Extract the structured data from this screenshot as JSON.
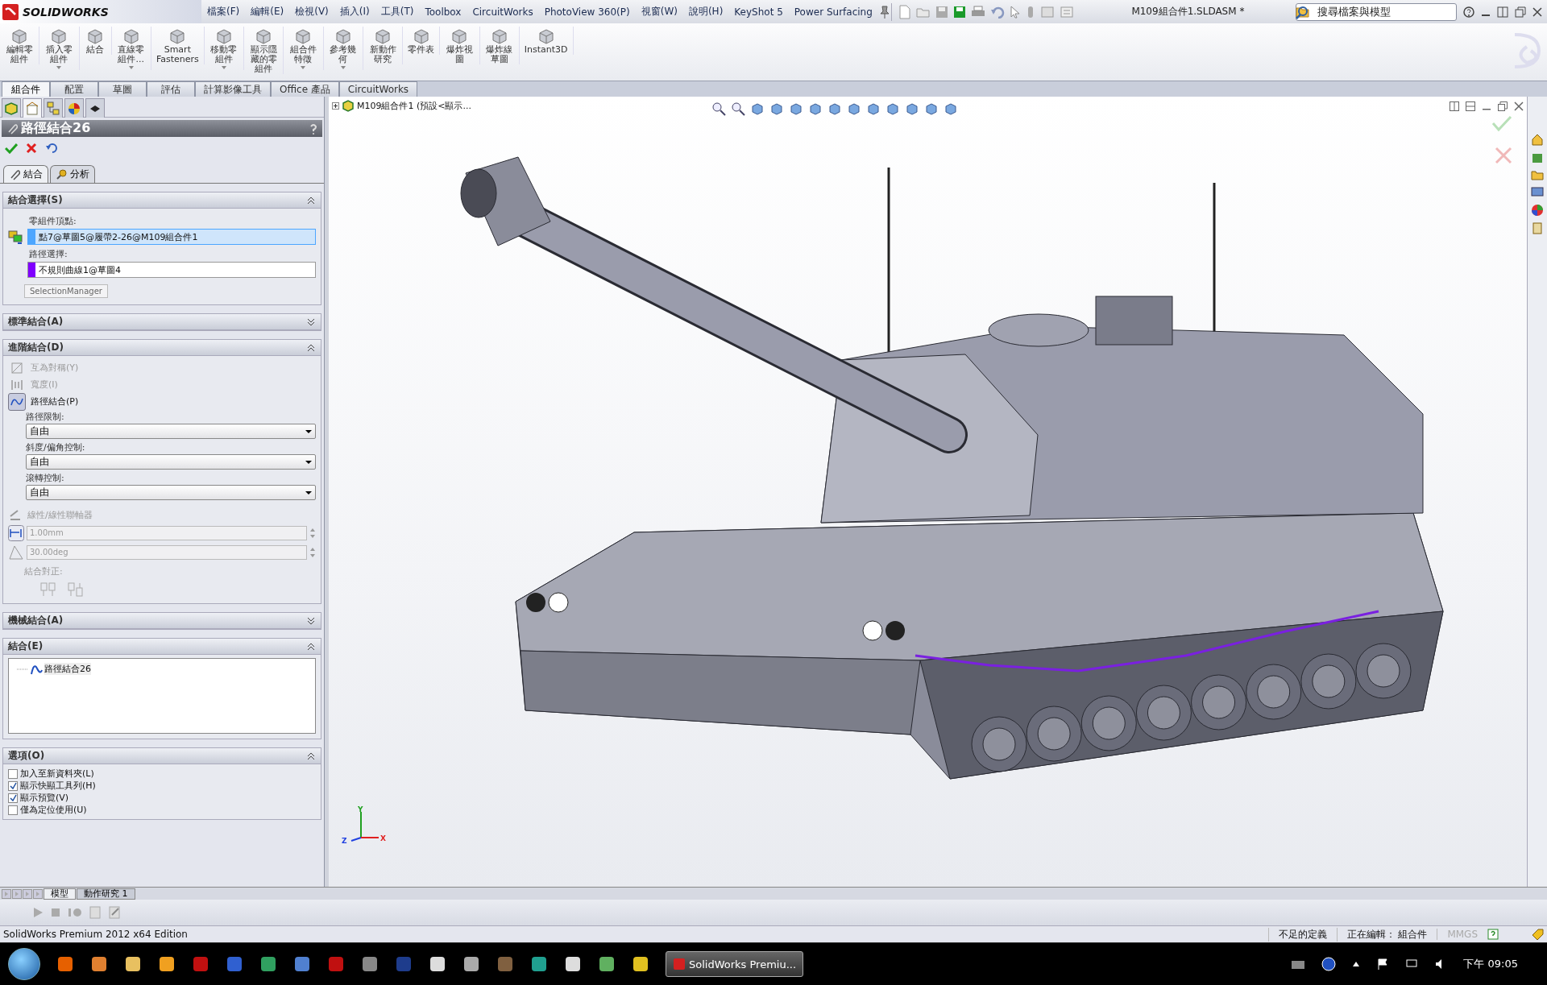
{
  "title_bar": {
    "logo": "SOLIDWORKS",
    "menu": [
      "檔案(F)",
      "編輯(E)",
      "檢視(V)",
      "插入(I)",
      "工具(T)",
      "Toolbox",
      "CircuitWorks",
      "PhotoView 360(P)",
      "視窗(W)",
      "說明(H)",
      "KeyShot 5",
      "Power Surfacing"
    ],
    "document_title": "M109組合件1.SLDASM *",
    "search": {
      "placeholder": "搜尋檔案與模型"
    }
  },
  "ribbon": [
    {
      "label": "編輯零組件",
      "dropdown": false
    },
    {
      "label": "插入零組件",
      "dropdown": true
    },
    {
      "label": "結合",
      "dropdown": false
    },
    {
      "label": "直線零組件...",
      "dropdown": true
    },
    {
      "label": "Smart Fasteners",
      "dropdown": false
    },
    {
      "label": "移動零組件",
      "dropdown": true
    },
    {
      "label": "顯示隱藏的零組件",
      "dropdown": false
    },
    {
      "label": "組合件特徵",
      "dropdown": true
    },
    {
      "label": "參考幾何",
      "dropdown": true
    },
    {
      "label": "新動作研究",
      "dropdown": false
    },
    {
      "label": "零件表",
      "dropdown": false
    },
    {
      "label": "爆炸視圖",
      "dropdown": false
    },
    {
      "label": "爆炸線草圖",
      "dropdown": false
    },
    {
      "label": "Instant3D",
      "dropdown": false
    }
  ],
  "command_tabs": [
    {
      "label": "組合件",
      "selected": true
    },
    {
      "label": "配置",
      "selected": false
    },
    {
      "label": "草圖",
      "selected": false
    },
    {
      "label": "評估",
      "selected": false
    },
    {
      "label": "計算影像工具",
      "selected": false
    },
    {
      "label": "Office 產品",
      "selected": false
    },
    {
      "label": "CircuitWorks",
      "selected": false
    }
  ],
  "manager_tabs": [
    {
      "selected": false
    },
    {
      "selected": true
    },
    {
      "selected": false
    },
    {
      "selected": false
    },
    {
      "selected": false
    }
  ],
  "property_manager": {
    "title": "路徑結合26",
    "tabs": [
      {
        "label": "結合",
        "selected": true
      },
      {
        "label": "分析",
        "selected": false
      }
    ],
    "sections": [
      {
        "kind": "selections",
        "title": "結合選擇(S)",
        "expanded": true,
        "fields": [
          {
            "label": "零組件頂點:",
            "value": "點7@草圖5@履帶2-26@M109組合件1",
            "color": "#4da6ff",
            "selected": true
          },
          {
            "label": "路徑選擇:",
            "value": "不規則曲線1@草圖4",
            "color": "#8000ff",
            "selected": false
          }
        ],
        "button": "SelectionManager"
      },
      {
        "title": "標準結合(A)",
        "expanded": false
      },
      {
        "kind": "advanced",
        "title": "進階結合(D)",
        "expanded": true,
        "types": [
          {
            "label": "互為對稱(Y)",
            "disabled": true,
            "selected": false
          },
          {
            "label": "寬度(I)",
            "disabled": true,
            "selected": false
          },
          {
            "label": "路徑結合(P)",
            "disabled": false,
            "selected": true
          }
        ],
        "dropdowns": [
          {
            "label": "路徑限制:",
            "value": "自由"
          },
          {
            "label": "斜度/偏角控制:",
            "value": "自由"
          },
          {
            "label": "滾轉控制:",
            "value": "自由"
          }
        ],
        "coupler": {
          "label": "線性/線性聯軸器",
          "disabled": true
        },
        "spinners": [
          {
            "value": "1.00mm",
            "disabled": true
          },
          {
            "value": "30.00deg",
            "disabled": true
          }
        ],
        "alignment_label": "結合對正:"
      },
      {
        "title": "機械結合(A)",
        "expanded": false
      },
      {
        "kind": "list",
        "title": "結合(E)",
        "expanded": true,
        "items": [
          "路徑結合26"
        ]
      },
      {
        "kind": "options",
        "title": "選項(O)",
        "expanded": true,
        "checkboxes": [
          {
            "label": "加入至新資料夾(L)",
            "checked": false
          },
          {
            "label": "顯示快顯工具列(H)",
            "checked": true
          },
          {
            "label": "顯示預覽(V)",
            "checked": true
          },
          {
            "label": "僅為定位使用(U)",
            "checked": false
          }
        ]
      }
    ]
  },
  "viewport": {
    "tree_label": "M109組合件1 (預設<顯示...",
    "triad": [
      "Y",
      "Z",
      "X"
    ]
  },
  "bottom_tabs": [
    {
      "label": "模型",
      "selected": true
    },
    {
      "label": "動作研究 1",
      "selected": false
    }
  ],
  "status_bar": {
    "edition": "SolidWorks Premium 2012 x64 Edition",
    "fields": [
      "不足的定義",
      "正在編輯： 組合件",
      "MMGS"
    ]
  },
  "taskbar": {
    "active_window": "SolidWorks Premiu...",
    "clock": "下午 09:05"
  }
}
